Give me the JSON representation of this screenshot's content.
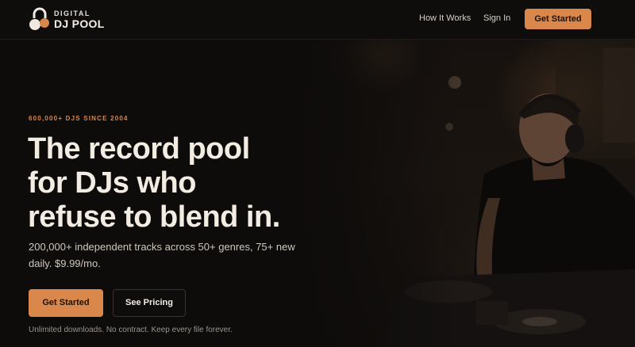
{
  "brand": {
    "name_top": "DIGITAL",
    "name_bottom": "DJ POOL",
    "accent_color": "#d9874a"
  },
  "nav": {
    "how_it_works": "How It Works",
    "sign_in": "Sign In",
    "cta": "Get Started"
  },
  "hero": {
    "eyebrow": "600,000+ DJS SINCE 2004",
    "headline_lines": [
      "The record pool",
      "for DJs who",
      "refuse to blend in."
    ],
    "subcopy": "200,000+ independent tracks across 50+ genres, 75+ new daily. $9.99/mo.",
    "primary_button": "Get Started",
    "secondary_button": "See Pricing",
    "footnote": "Unlimited downloads. No contract. Keep every file forever."
  },
  "icons": {
    "logo": "headphone-lock-logo-icon"
  }
}
